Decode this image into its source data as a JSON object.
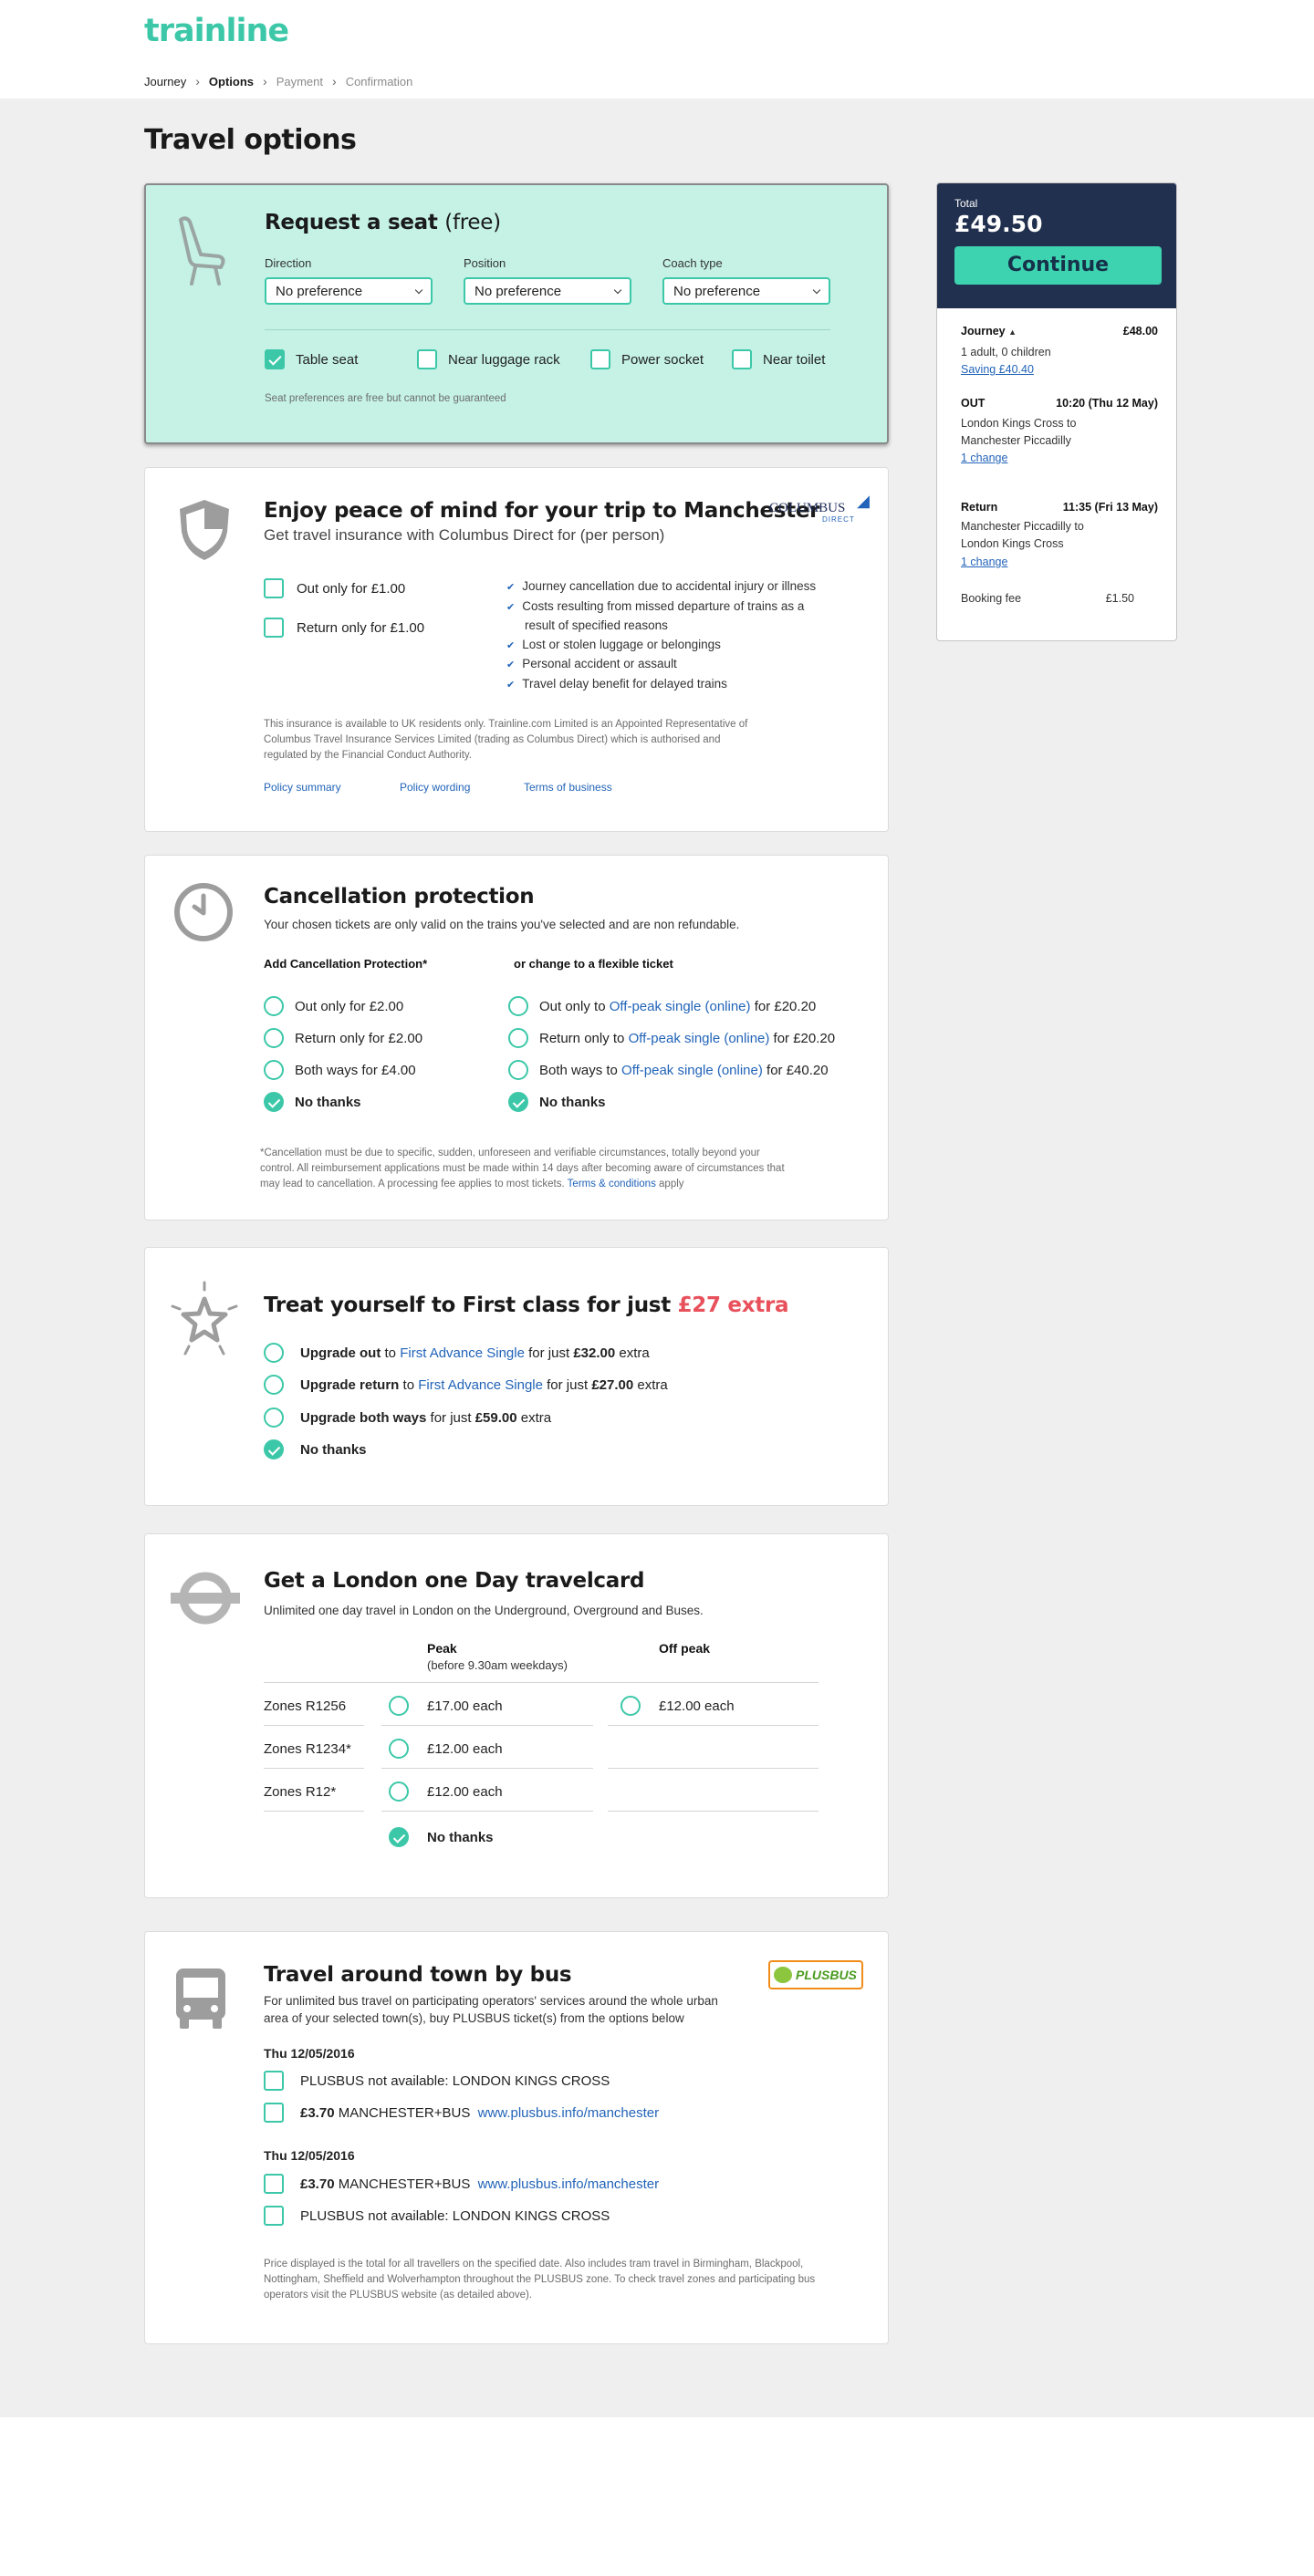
{
  "header": {
    "logo": "trainline",
    "breadcrumbs": [
      "Journey",
      "Options",
      "Payment",
      "Confirmation"
    ]
  },
  "page_title": "Travel options",
  "seat": {
    "title": "Request a seat",
    "title_suffix": "(free)",
    "direction_label": "Direction",
    "position_label": "Position",
    "coach_label": "Coach type",
    "direction_value": "No preference",
    "position_value": "No preference",
    "coach_value": "No preference",
    "options": [
      {
        "label": "Table seat",
        "checked": true
      },
      {
        "label": "Near luggage rack",
        "checked": false
      },
      {
        "label": "Power socket",
        "checked": false
      },
      {
        "label": "Near toilet",
        "checked": false
      }
    ],
    "note": "Seat preferences are free but cannot be guaranteed"
  },
  "insurance": {
    "title": "Enjoy peace of mind for your trip to Manchester",
    "subtitle": "Get travel insurance with Columbus Direct for (per person)",
    "logo_top": "COLUMBUS",
    "logo_bottom": "DIRECT",
    "options": [
      "Out only for £1.00",
      "Return only for £1.00"
    ],
    "benefits": [
      "Journey cancellation due to accidental injury or illness",
      "Costs resulting from missed departure of trains as a",
      "result of specified reasons",
      "Lost or stolen luggage or belongings",
      "Personal accident or assault",
      "Travel delay benefit for delayed trains"
    ],
    "legal": [
      "This insurance is available to UK residents only. Trainline.com Limited is an Appointed Representative of",
      "Columbus Travel Insurance Services Limited (trading as Columbus Direct) which is authorised and",
      "regulated by the Financial Conduct Authority."
    ],
    "links": [
      "Policy summary",
      "Policy wording",
      "Terms of business"
    ]
  },
  "cancel": {
    "title": "Cancellation protection",
    "subtitle": "Your chosen tickets are only valid on the trains you've selected and are non refundable.",
    "left_heading": "Add Cancellation Protection*",
    "right_heading": "or change to a flexible ticket",
    "left": [
      "Out only for £2.00",
      "Return only for £2.00",
      "Both ways for £4.00",
      "No thanks"
    ],
    "right": [
      {
        "pre": "Out only to ",
        "link": "Off-peak single (online)",
        "post": " for £20.20"
      },
      {
        "pre": "Return only to ",
        "link": "Off-peak single (online)",
        "post": " for £20.20"
      },
      {
        "pre": "Both ways  to ",
        "link": "Off-peak single (online)",
        "post": " for £40.20"
      }
    ],
    "no_thanks": "No thanks",
    "fine": [
      "*Cancellation must be due to specific, sudden, unforeseen and verifiable circumstances, totally beyond your",
      "control. All reimbursement applications must be made within 14 days after becoming aware of circumstances that",
      "may lead to cancellation. A processing fee applies to most tickets. "
    ],
    "terms_link": "Terms & conditions",
    "terms_post": " apply"
  },
  "first": {
    "title": "Treat yourself to First class for just ",
    "title_price": "£27 extra",
    "rows": [
      {
        "b": "Upgrade out",
        "mid": " to ",
        "link": "First Advance Single",
        "post1": " for just ",
        "price": "£32.00",
        "post2": " extra"
      },
      {
        "b": "Upgrade return",
        "mid": " to ",
        "link": "First Advance Single",
        "post1": " for just ",
        "price": "£27.00",
        "post2": " extra"
      },
      {
        "b": "Upgrade both ways",
        "mid": "",
        "link": "",
        "post1": " for just ",
        "price": "£59.00",
        "post2": " extra"
      }
    ],
    "no_thanks": "No thanks"
  },
  "travelcard": {
    "title": "Get a London one Day travelcard",
    "subtitle": "Unlimited one day travel in London on the Underground, Overground and Buses.",
    "peak": "Peak",
    "peak_sub": "(before 9.30am weekdays)",
    "offpeak": "Off peak",
    "zones": [
      "Zones R1256",
      "Zones R1234*",
      "Zones R12*"
    ],
    "peak_prices": [
      "£17.00 each",
      "£12.00 each",
      "£12.00 each"
    ],
    "offpeak_price": "£12.00 each",
    "no_thanks": "No thanks"
  },
  "bus": {
    "title": "Travel around town by bus",
    "subtitle": [
      "For unlimited bus travel on participating operators' services around the whole urban",
      "area of your selected town(s), buy PLUSBUS ticket(s) from the options below"
    ],
    "logo": "PLUSBUS",
    "date1": "Thu 12/05/2016",
    "date2": "Thu 12/05/2016",
    "na": "PLUSBUS not available: LONDON KINGS CROSS",
    "price": "£3.70",
    "dest": "MANCHESTER+BUS",
    "link": "www.plusbus.info/manchester",
    "fine": [
      "Price displayed is the total for all travellers on the specified date. Also includes tram travel in Birmingham, Blackpool,",
      "Nottingham, Sheffield and Wolverhampton throughout the PLUSBUS zone. To check travel zones and participating bus",
      "operators visit the PLUSBUS website (as detailed above)."
    ]
  },
  "summary": {
    "total_label": "Total",
    "total": "£49.50",
    "continue": "Continue",
    "journey_label": "Journey",
    "journey_price": "£48.00",
    "passengers": "1 adult, 0 children",
    "saving": "Saving £40.40",
    "out_label": "OUT",
    "out_time": "10:20 (Thu 12 May)",
    "out_route": [
      "London Kings Cross to",
      "Manchester Piccadilly"
    ],
    "out_change": "1 change",
    "ret_label": "Return",
    "ret_time": "11:35 (Fri 13 May)",
    "ret_route": [
      "Manchester Piccadilly to",
      "London Kings Cross"
    ],
    "ret_change": "1 change",
    "fee_label": "Booking fee",
    "fee": "£1.50"
  },
  "colors": {
    "accent": "#3cc8a8",
    "link": "#2264b8",
    "seat_bg": "#c5f2e5",
    "summary_bg": "#22304f",
    "highlight": "#e8505b"
  }
}
